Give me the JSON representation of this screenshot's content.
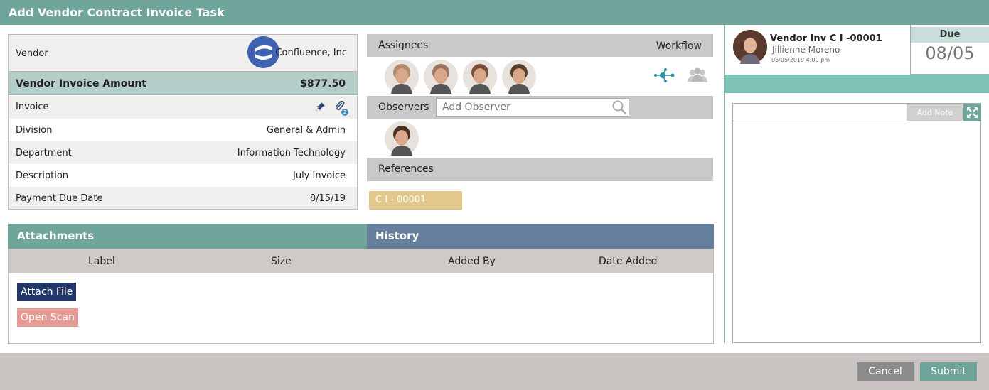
{
  "app": {
    "title": "Add Vendor Contract Invoice Task"
  },
  "vendor_panel": {
    "vendor_label": "Vendor",
    "vendor_name": "Confluence, Inc",
    "amount_label": "Vendor Invoice Amount",
    "amount_value": "$877.50",
    "invoice_label": "Invoice",
    "attachment_count": "2",
    "division_label": "Division",
    "division_value": "General & Admin",
    "department_label": "Department",
    "department_value": "Information Technology",
    "description_label": "Description",
    "description_value": "July Invoice",
    "payment_due_label": "Payment Due Date",
    "payment_due_value": "8/15/19"
  },
  "assignees": {
    "label": "Assignees",
    "workflow_label": "Workflow",
    "avatar_colors": [
      "#b38a6e",
      "#9a7560",
      "#7a4e3a",
      "#5a3c2c"
    ]
  },
  "observers": {
    "label": "Observers",
    "placeholder": "Add Observer",
    "avatar_colors": [
      "#4a2f24"
    ]
  },
  "references": {
    "label": "References",
    "items": [
      "C I - 00001"
    ]
  },
  "attachments": {
    "title": "Attachments",
    "columns": [
      "Label",
      "Size",
      "Added By",
      "Date Added"
    ],
    "attach_button": "Attach File",
    "scan_button": "Open Scan"
  },
  "history": {
    "title": "History"
  },
  "task": {
    "title": "Vendor Inv C I -00001",
    "person": "Jillienne Moreno",
    "datetime": "05/05/2019 4:00 pm",
    "due_label": "Due",
    "due_value": "08/05"
  },
  "notes": {
    "add_button": "Add Note"
  },
  "footer": {
    "cancel": "Cancel",
    "submit": "Submit"
  },
  "colors": {
    "teal": "#6fa59b",
    "slate_blue": "#667f9d",
    "navy": "#233768",
    "salmon": "#e59a93",
    "reference_tag": "#e3c88d"
  }
}
